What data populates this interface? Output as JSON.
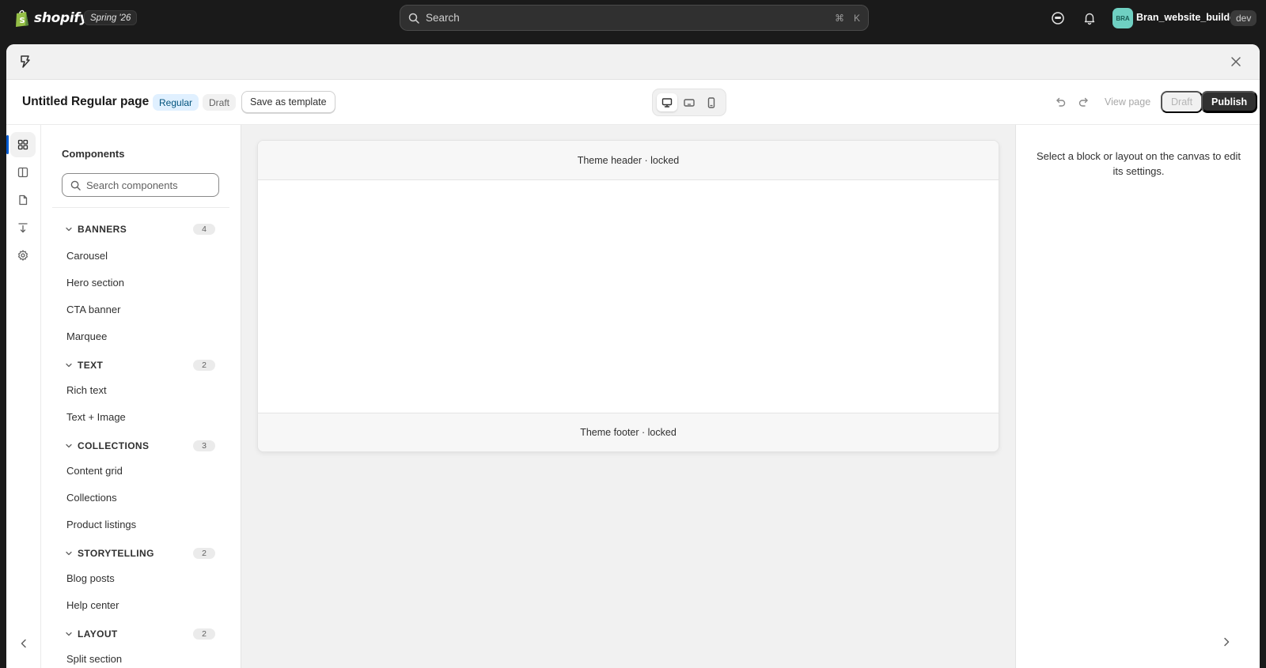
{
  "topbar": {
    "brand": "shopify",
    "edition": "Spring '26",
    "search_placeholder": "Search",
    "shortcut_mod": "⌘",
    "shortcut_key": "K",
    "avatar_initials": "BRA",
    "store_name": "Bran_website_builder",
    "env_badge": "dev"
  },
  "page": {
    "title": "Untitled Regular page",
    "type_badge": "Regular",
    "status_badge": "Draft",
    "save_template_label": "Save as template",
    "view_page_label": "View page",
    "draft_button_label": "Draft",
    "publish_button_label": "Publish"
  },
  "components": {
    "title": "Components",
    "search_placeholder": "Search components",
    "groups": [
      {
        "name": "BANNERS",
        "count": "4",
        "items": [
          "Carousel",
          "Hero section",
          "CTA banner",
          "Marquee"
        ]
      },
      {
        "name": "TEXT",
        "count": "2",
        "items": [
          "Rich text",
          "Text + Image"
        ]
      },
      {
        "name": "COLLECTIONS",
        "count": "3",
        "items": [
          "Content grid",
          "Collections",
          "Product listings"
        ]
      },
      {
        "name": "STORYTELLING",
        "count": "2",
        "items": [
          "Blog posts",
          "Help center"
        ]
      },
      {
        "name": "LAYOUT",
        "count": "2",
        "items": [
          "Split section"
        ]
      }
    ]
  },
  "canvas": {
    "header_label": "Theme header · locked",
    "footer_label": "Theme footer · locked"
  },
  "settings": {
    "hint": "Select a block or layout on the canvas to edit its settings."
  },
  "colors": {
    "topbar_bg": "#1a1a1a",
    "primary_button": "#303030",
    "accent_blue": "#005bd3",
    "avatar_bg": "#6fd0c2"
  }
}
